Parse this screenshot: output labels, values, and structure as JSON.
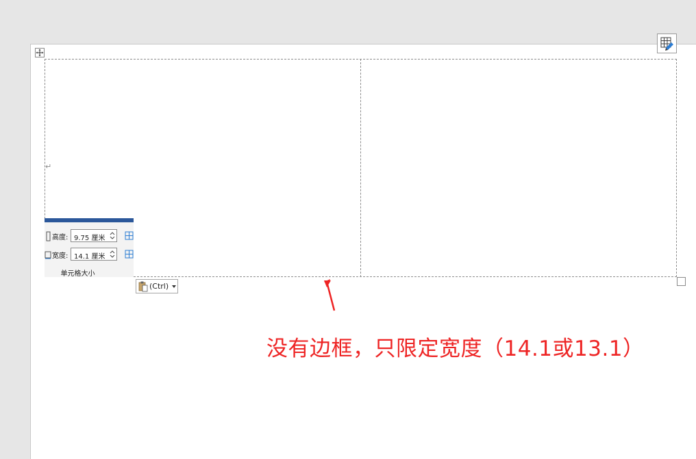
{
  "ribbon": {
    "height_label": "高度:",
    "height_value": "9.75 厘米",
    "width_label": "宽度:",
    "width_value": "14.1 厘米",
    "group_label": "单元格大小"
  },
  "paste_options": {
    "label": "(Ctrl)"
  },
  "annotation": {
    "text": "没有边框，只限定宽度（14.1或13.1）",
    "color": "#ee2424"
  },
  "document": {
    "paragraph_mark": "↵"
  },
  "colors": {
    "ribbon_accent": "#2b579a",
    "page": "#ffffff",
    "workspace": "#e6e6e6"
  },
  "icons": [
    "move-icon",
    "layout-options-icon",
    "height-icon",
    "width-icon",
    "spin-up-icon",
    "spin-down-icon",
    "clipboard-icon",
    "dropdown-arrow-icon",
    "distribute-rows-icon",
    "distribute-columns-icon",
    "annotation-arrow-icon"
  ]
}
